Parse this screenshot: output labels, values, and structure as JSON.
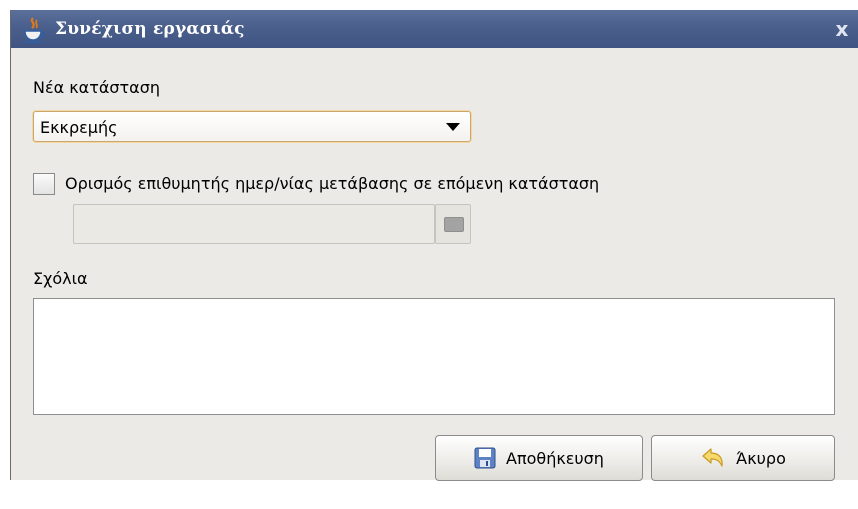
{
  "window": {
    "title": "Συνέχιση εργασιάς",
    "close_label": "x"
  },
  "new_status": {
    "label": "Νέα κατάσταση",
    "selected": "Εκκρεμής"
  },
  "transition_date": {
    "checkbox_label": "Ορισμός επιθυμητής ημερ/νίας μετάβασης σε επόμενη κατάσταση",
    "checked": false,
    "value": ""
  },
  "comments": {
    "label": "Σχόλια",
    "value": ""
  },
  "buttons": {
    "save_label": "Αποθήκευση",
    "cancel_label": "Άκυρο"
  },
  "icons": {
    "app": "java-cup-icon",
    "save": "floppy-disk-icon",
    "cancel": "undo-arrow-icon",
    "calendar": "calendar-icon"
  },
  "colors": {
    "titlebar": "#4a5f8c",
    "dialog_bg": "#eceae6",
    "select_focus": "#f2d7a5"
  }
}
